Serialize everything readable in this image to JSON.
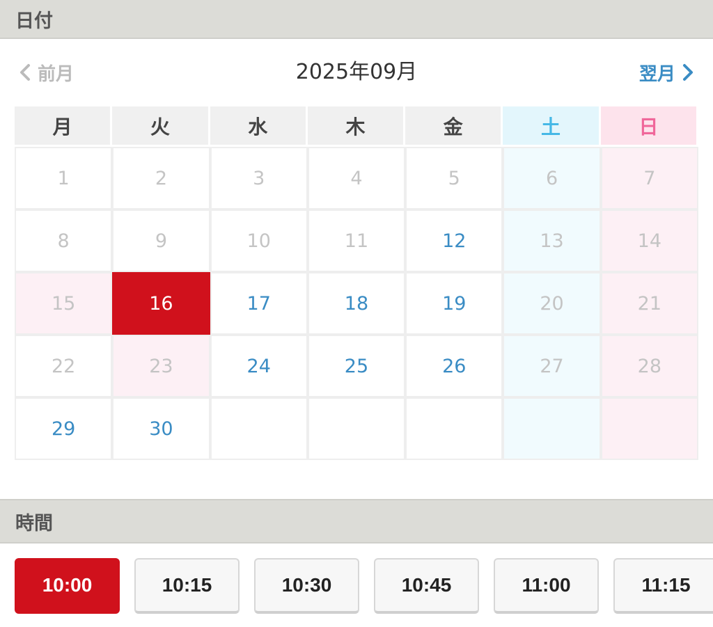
{
  "date_section": {
    "title": "日付"
  },
  "month_nav": {
    "prev_label": "前月",
    "next_label": "翌月",
    "current_month": "2025年09月"
  },
  "weekdays": [
    "月",
    "火",
    "水",
    "木",
    "金",
    "土",
    "日"
  ],
  "weeks": [
    [
      {
        "day": "1",
        "state": "disabled"
      },
      {
        "day": "2",
        "state": "disabled"
      },
      {
        "day": "3",
        "state": "disabled"
      },
      {
        "day": "4",
        "state": "disabled"
      },
      {
        "day": "5",
        "state": "disabled"
      },
      {
        "day": "6",
        "state": "disabled"
      },
      {
        "day": "7",
        "state": "disabled"
      }
    ],
    [
      {
        "day": "8",
        "state": "disabled"
      },
      {
        "day": "9",
        "state": "disabled"
      },
      {
        "day": "10",
        "state": "disabled"
      },
      {
        "day": "11",
        "state": "disabled"
      },
      {
        "day": "12",
        "state": "available"
      },
      {
        "day": "13",
        "state": "disabled"
      },
      {
        "day": "14",
        "state": "disabled"
      }
    ],
    [
      {
        "day": "15",
        "state": "disabled",
        "holiday": true
      },
      {
        "day": "16",
        "state": "selected"
      },
      {
        "day": "17",
        "state": "available"
      },
      {
        "day": "18",
        "state": "available"
      },
      {
        "day": "19",
        "state": "available"
      },
      {
        "day": "20",
        "state": "disabled"
      },
      {
        "day": "21",
        "state": "disabled"
      }
    ],
    [
      {
        "day": "22",
        "state": "disabled"
      },
      {
        "day": "23",
        "state": "disabled",
        "holiday": true
      },
      {
        "day": "24",
        "state": "available"
      },
      {
        "day": "25",
        "state": "available"
      },
      {
        "day": "26",
        "state": "available"
      },
      {
        "day": "27",
        "state": "disabled"
      },
      {
        "day": "28",
        "state": "disabled"
      }
    ],
    [
      {
        "day": "29",
        "state": "available"
      },
      {
        "day": "30",
        "state": "available"
      },
      {
        "day": "",
        "state": "empty"
      },
      {
        "day": "",
        "state": "empty"
      },
      {
        "day": "",
        "state": "empty"
      },
      {
        "day": "",
        "state": "empty"
      },
      {
        "day": "",
        "state": "empty"
      }
    ]
  ],
  "time_section": {
    "title": "時間"
  },
  "time_slots": [
    {
      "label": "10:00",
      "selected": true
    },
    {
      "label": "10:15",
      "selected": false
    },
    {
      "label": "10:30",
      "selected": false
    },
    {
      "label": "10:45",
      "selected": false
    },
    {
      "label": "11:00",
      "selected": false
    },
    {
      "label": "11:15",
      "selected": false
    }
  ],
  "colors": {
    "accent_red": "#d0111c",
    "link_blue": "#3a8cc4",
    "saturday_blue": "#45b8e6",
    "sunday_pink": "#f0679a"
  },
  "icons": {
    "prev": "chevron-left-icon",
    "next": "chevron-right-icon"
  }
}
